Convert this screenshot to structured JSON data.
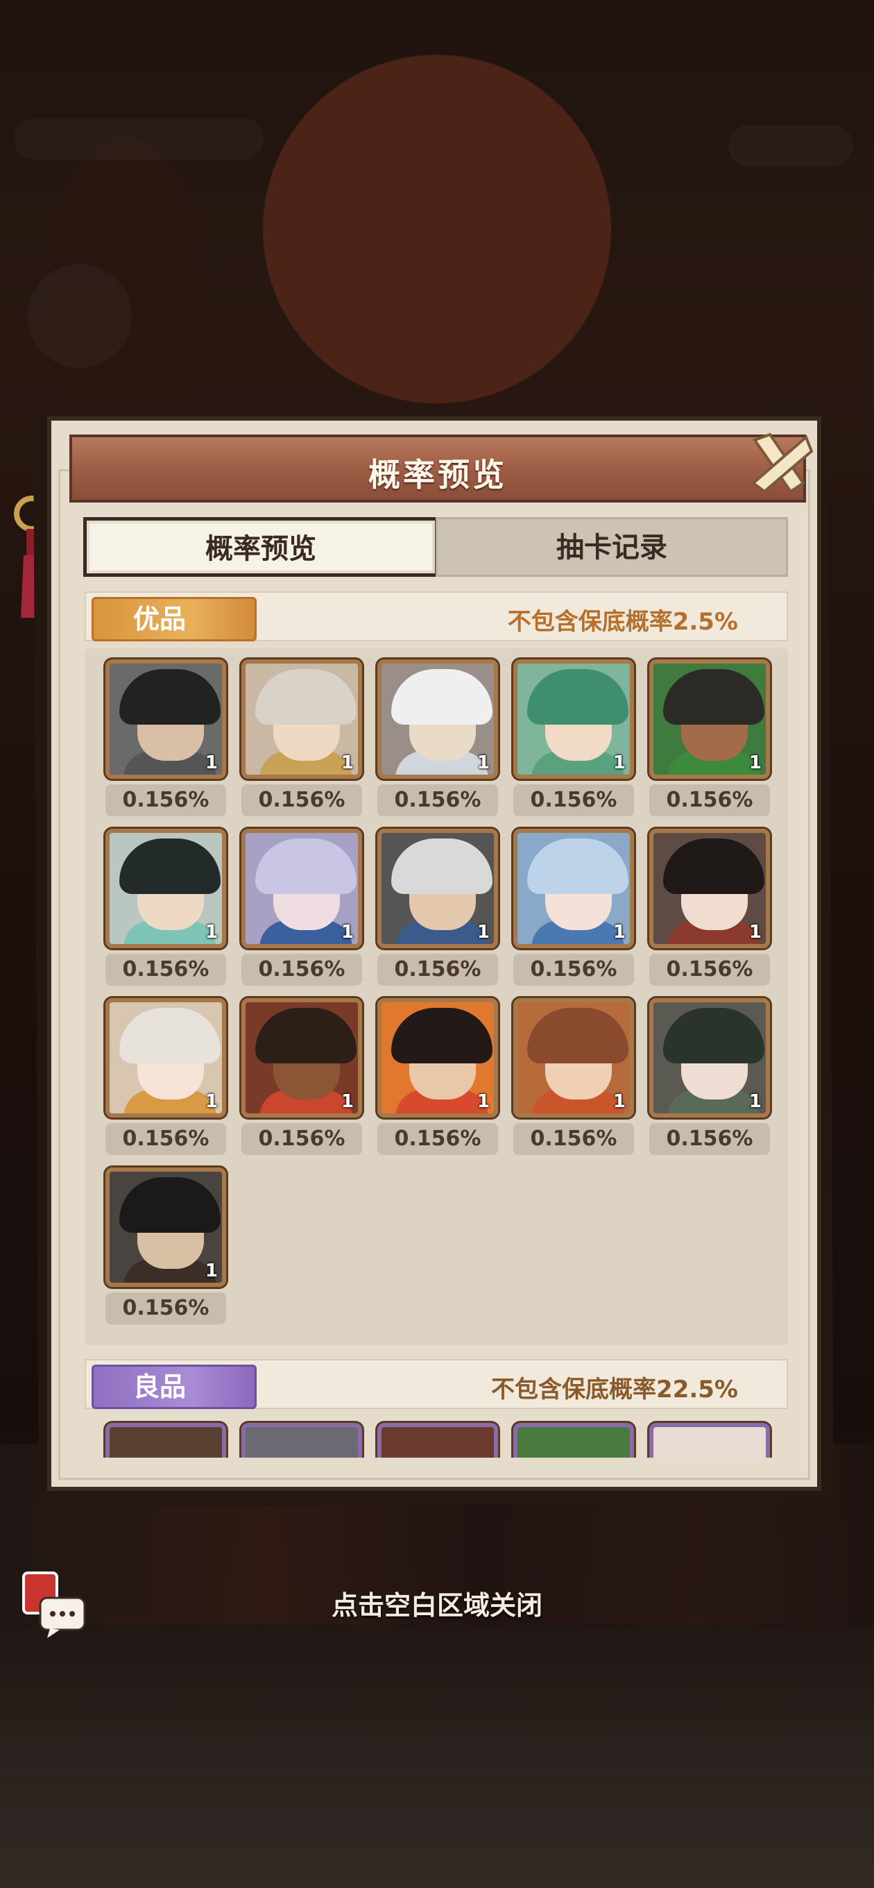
{
  "header": {
    "title": "概率预览",
    "close_icon": "close-x-icon"
  },
  "tabs": [
    {
      "label": "概率预览",
      "active": true
    },
    {
      "label": "抽卡记录",
      "active": false
    }
  ],
  "sections": [
    {
      "tag": "优品",
      "note": "不包含保底概率2.5%",
      "accent": "#d9943e",
      "heroes": [
        {
          "count": "1",
          "rate": "0.156%",
          "hair": "#222222",
          "skin": "#d9bfa8",
          "body": "#555555",
          "bg": "#6a6a6a"
        },
        {
          "count": "1",
          "rate": "0.156%",
          "hair": "#d8d2c8",
          "skin": "#eed8c2",
          "body": "#c9a255",
          "bg": "#c8b8a4"
        },
        {
          "count": "1",
          "rate": "0.156%",
          "hair": "#efefef",
          "skin": "#eadbc8",
          "body": "#cfd6dc",
          "bg": "#9a8f88"
        },
        {
          "count": "1",
          "rate": "0.156%",
          "hair": "#3f8e6e",
          "skin": "#f1dbc6",
          "body": "#5aa27e",
          "bg": "#7fb59a"
        },
        {
          "count": "1",
          "rate": "0.156%",
          "hair": "#2c2a26",
          "skin": "#a36b4a",
          "body": "#3d8a3f",
          "bg": "#3f7a3f"
        },
        {
          "count": "1",
          "rate": "0.156%",
          "hair": "#222a2a",
          "skin": "#eed9c4",
          "body": "#7cc4b6",
          "bg": "#b9c7c0"
        },
        {
          "count": "1",
          "rate": "0.156%",
          "hair": "#c8c6e4",
          "skin": "#f0dde2",
          "body": "#3b5e9c",
          "bg": "#a7a2c4"
        },
        {
          "count": "1",
          "rate": "0.156%",
          "hair": "#d9d9d9",
          "skin": "#e3c8ae",
          "body": "#3b5b8c",
          "bg": "#555"
        },
        {
          "count": "1",
          "rate": "0.156%",
          "hair": "#bcd3ea",
          "skin": "#f4e1d8",
          "body": "#4a78b0",
          "bg": "#8aa8c8"
        },
        {
          "count": "1",
          "rate": "0.156%",
          "hair": "#1f1a18",
          "skin": "#f1dcd0",
          "body": "#8a3b2e",
          "bg": "#5e4b44"
        },
        {
          "count": "1",
          "rate": "0.156%",
          "hair": "#e8e2dc",
          "skin": "#f5e3d6",
          "body": "#d99a45",
          "bg": "#d9c6b0"
        },
        {
          "count": "1",
          "rate": "0.156%",
          "hair": "#2b1f18",
          "skin": "#8a5636",
          "body": "#c8472e",
          "bg": "#7a3a28"
        },
        {
          "count": "1",
          "rate": "0.156%",
          "hair": "#231a18",
          "skin": "#e8c8a8",
          "body": "#d84a2e",
          "bg": "#e0782f"
        },
        {
          "count": "1",
          "rate": "0.156%",
          "hair": "#8a4a2e",
          "skin": "#f0d0b4",
          "body": "#c9552a",
          "bg": "#b76a3a"
        },
        {
          "count": "1",
          "rate": "0.156%",
          "hair": "#2a332c",
          "skin": "#efdcd2",
          "body": "#5a6a5a",
          "bg": "#5a5a52"
        },
        {
          "count": "1",
          "rate": "0.156%",
          "hair": "#1a1a1a",
          "skin": "#d8c0a4",
          "body": "#3a2e26",
          "bg": "#4a4440"
        }
      ]
    },
    {
      "tag": "良品",
      "note": "不包含保底概率22.5%",
      "accent": "#8f6fc0"
    }
  ],
  "footer": {
    "hint": "点击空白区域关闭",
    "chat_icon": "chat-envelope-icon"
  }
}
